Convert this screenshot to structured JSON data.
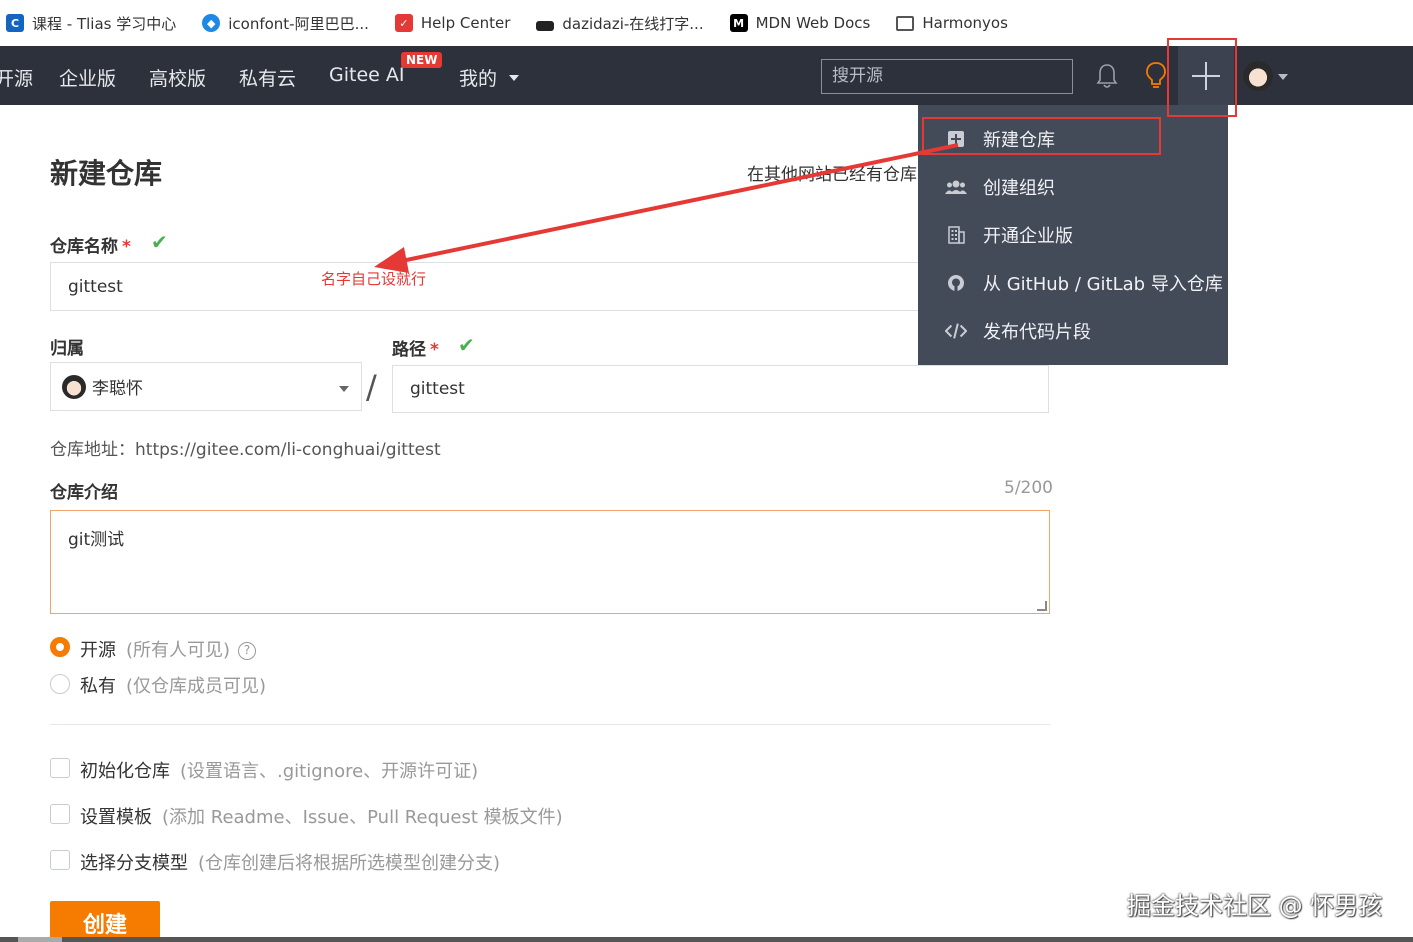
{
  "bookmarks": [
    {
      "label": "课程 - Tlias 学习中心",
      "icon": "course-icon",
      "color": "#1565c0"
    },
    {
      "label": "iconfont-阿里巴巴...",
      "icon": "iconfont-icon",
      "color": "#1e88e5"
    },
    {
      "label": "Help Center",
      "icon": "help-center-icon",
      "color": "#e53935"
    },
    {
      "label": "dazidazi-在线打字...",
      "icon": "dazidazi-icon",
      "color": "#222222"
    },
    {
      "label": "MDN Web Docs",
      "icon": "mdn-icon",
      "color": "#000000"
    },
    {
      "label": "Harmonyos",
      "icon": "folder-icon",
      "color": "#555555"
    }
  ],
  "nav": {
    "items": [
      "开源",
      "企业版",
      "高校版",
      "私有云",
      "Gitee AI",
      "我的"
    ],
    "new_badge": "NEW",
    "search_placeholder": "搜开源"
  },
  "form": {
    "title": "新建仓库",
    "import_hint": "在其他网站已经有仓库",
    "name_label": "仓库名称",
    "required_mark": "*",
    "name_value": "gittest",
    "annotation": "名字自己设就行",
    "owner_label": "归属",
    "owner_value": "李聪怀",
    "slash": "/",
    "path_label": "路径",
    "path_value": "gittest",
    "address": "仓库地址：https://gitee.com/li-conghuai/gittest",
    "intro_label": "仓库介绍",
    "intro_counter": "5/200",
    "intro_value": "git测试",
    "visibility": [
      {
        "label": "开源",
        "hint": "(所有人可见)",
        "selected": true
      },
      {
        "label": "私有",
        "hint": "(仅仓库成员可见)",
        "selected": false
      }
    ],
    "options": [
      {
        "label": "初始化仓库",
        "hint": "(设置语言、.gitignore、开源许可证)",
        "checked": false
      },
      {
        "label": "设置模板",
        "hint": "(添加 Readme、Issue、Pull Request 模板文件)",
        "checked": false
      },
      {
        "label": "选择分支模型",
        "hint": "(仓库创建后将根据所选模型创建分支)",
        "checked": false
      }
    ],
    "help_glyph": "?",
    "create_button": "创建"
  },
  "dropdown": [
    {
      "label": "新建仓库",
      "icon": "plus-square-icon"
    },
    {
      "label": "创建组织",
      "icon": "users-icon"
    },
    {
      "label": "开通企业版",
      "icon": "building-icon"
    },
    {
      "label": "从 GitHub / GitLab 导入仓库",
      "icon": "github-icon"
    },
    {
      "label": "发布代码片段",
      "icon": "code-icon"
    }
  ],
  "watermark": "掘金技术社区 @ 怀男孩",
  "colors": {
    "accent": "#f57c00",
    "navbar": "#2c313c",
    "dropdown": "#434a58",
    "annotation": "#e53935",
    "check": "#4caf50"
  }
}
